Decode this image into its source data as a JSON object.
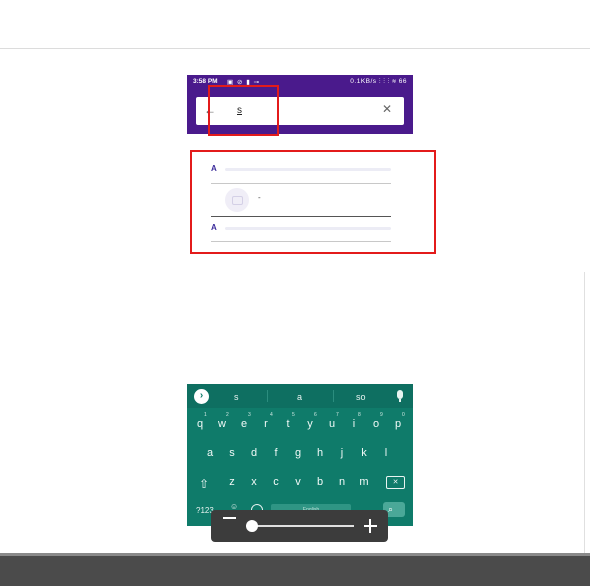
{
  "status_bar": {
    "time": "3:58 PM",
    "left_icons": "▣ ⊘ ▮ ⊸",
    "right_info": "0.1KB/s ⫶ ⫶ ⫶ ≋ 66"
  },
  "search": {
    "value": "s"
  },
  "results": {
    "sections": [
      "A",
      "A"
    ],
    "contact_name": "-"
  },
  "keyboard": {
    "suggestions": [
      "s",
      "a",
      "so"
    ],
    "row1": [
      "q",
      "w",
      "e",
      "r",
      "t",
      "y",
      "u",
      "i",
      "o",
      "p"
    ],
    "row1_nums": [
      "1",
      "2",
      "3",
      "4",
      "5",
      "6",
      "7",
      "8",
      "9",
      "0"
    ],
    "row2": [
      "a",
      "s",
      "d",
      "f",
      "g",
      "h",
      "j",
      "k",
      "l"
    ],
    "row3": [
      "z",
      "x",
      "c",
      "v",
      "b",
      "n",
      "m"
    ],
    "symbols_key": "?123",
    "emoji_key": "☺",
    "space_label": "English"
  },
  "icons": {
    "expand": "›",
    "back": "←",
    "clear": "✕",
    "shift": "⇧",
    "backspace": "✕",
    "enter": "⌕"
  },
  "colors": {
    "header_purple": "#4a1a8c",
    "highlight_red": "#e31b1b",
    "keyboard_teal": "#0f7b6a"
  }
}
